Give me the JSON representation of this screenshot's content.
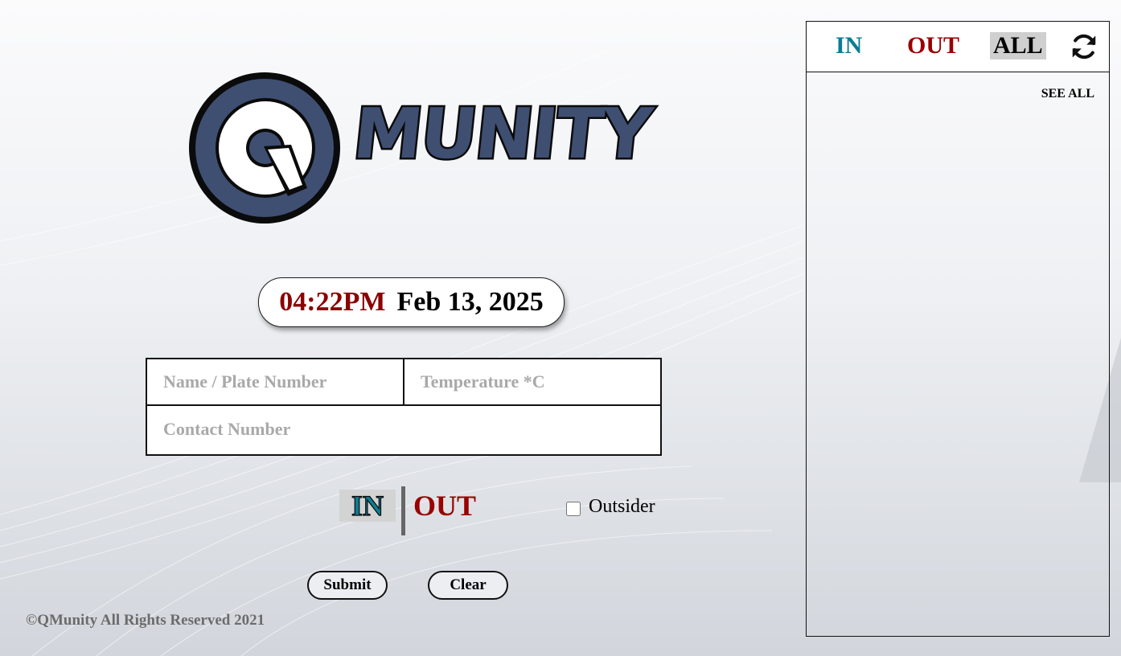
{
  "logo": {
    "mark": "Q",
    "word": "MUNITY"
  },
  "clock": {
    "time": "04:22PM",
    "date": "Feb 13, 2025"
  },
  "form": {
    "name_placeholder": "Name / Plate Number",
    "temperature_placeholder": "Temperature *C",
    "contact_placeholder": "Contact Number"
  },
  "direction": {
    "in_label": "IN",
    "out_label": "OUT",
    "selected": "IN"
  },
  "outsider": {
    "label": "Outsider",
    "checked": false
  },
  "buttons": {
    "submit": "Submit",
    "clear": "Clear"
  },
  "footer": {
    "text": "©QMunity All Rights Reserved 2021"
  },
  "panel": {
    "tabs": [
      "IN",
      "OUT",
      "ALL"
    ],
    "active_tab": "ALL",
    "refresh_icon": "refresh-icon",
    "see_all": "SEE ALL",
    "entries": []
  },
  "colors": {
    "in": "#0b7d91",
    "out": "#990000",
    "time": "#8b0000",
    "logo_fill": "#3f4f72",
    "active_tab_bg": "#cfcfcf"
  }
}
